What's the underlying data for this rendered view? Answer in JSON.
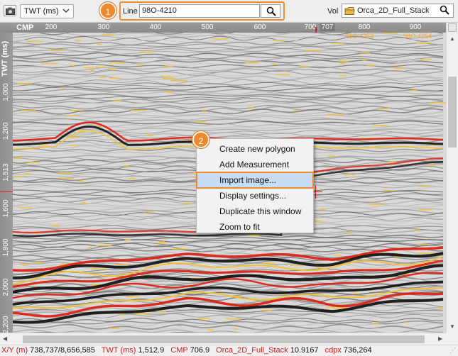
{
  "toolbar": {
    "domain_value": "TWT (ms)",
    "line_label": "Line",
    "line_value": "98O-4210",
    "vol_label": "Vol",
    "vol_value": "Orca_2D_Full_Stack"
  },
  "annotations": {
    "step_1": "1",
    "step_2": "2"
  },
  "axis": {
    "x_title": "CMP",
    "x_ticks": [
      "200",
      "300",
      "400",
      "500",
      "600",
      "700",
      "707",
      "800",
      "900"
    ],
    "y_title": "TWT (ms)",
    "y_ticks": [
      "1,000",
      "1,200",
      "1,513",
      "1,600",
      "1,800",
      "2,000",
      "2,200"
    ],
    "tie_lines": [
      "98O-4253",
      "98O-4254"
    ]
  },
  "context_menu": {
    "items": [
      "Create new polygon",
      "Add Measurement",
      "Import image...",
      "Display settings...",
      "Duplicate this window",
      "Zoom to fit"
    ],
    "highlighted_index": 2
  },
  "status": {
    "xy_label": "X/Y (m)",
    "xy_value": "738,737/8,656,585",
    "twt_label": "TWT (ms)",
    "twt_value": "1,512.9",
    "cmp_label": "CMP",
    "cmp_value": "706.9",
    "vol_label": "Orca_2D_Full_Stack",
    "vol_value": "10.9167",
    "cdpx_label": "cdpx",
    "cdpx_value": "736,264"
  },
  "colors": {
    "accent_orange": "#ee8a2c",
    "highlight_blue": "#c7dcf5",
    "status_key_red": "#d01818",
    "seismic_red": "#e01c10",
    "seismic_yellow": "#f2c230"
  },
  "icons": {
    "camera": "camera-icon",
    "dropdown": "chevron-down-icon",
    "search": "magnifier-icon",
    "volume": "folder-icon"
  }
}
